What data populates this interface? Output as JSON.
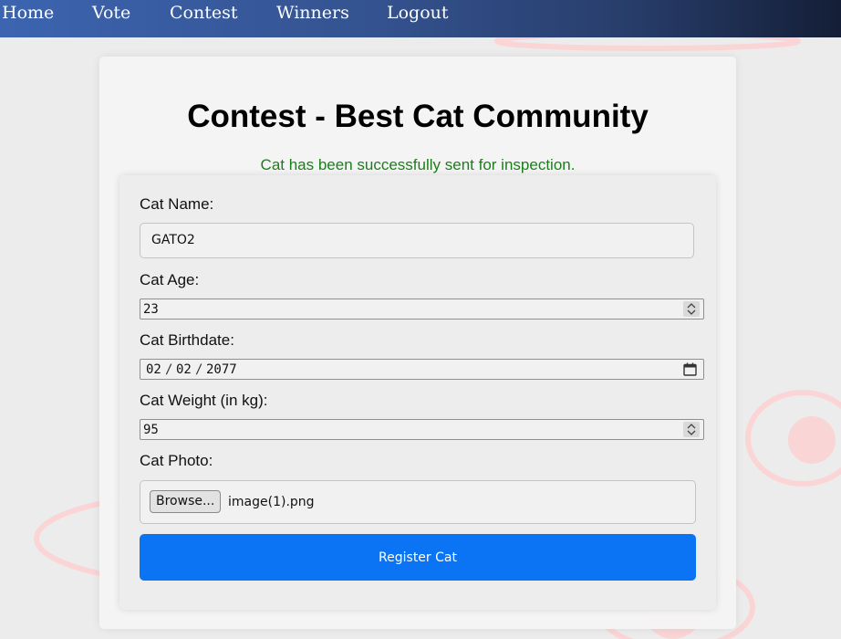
{
  "nav": {
    "items": [
      {
        "label": "Home"
      },
      {
        "label": "Vote"
      },
      {
        "label": "Contest"
      },
      {
        "label": "Winners"
      },
      {
        "label": "Logout"
      }
    ]
  },
  "page": {
    "title": "Contest - Best Cat Community",
    "success_message": "Cat has been successfully sent for inspection.",
    "success_color": "#1a7f1a"
  },
  "form": {
    "cat_name": {
      "label": "Cat Name:",
      "value": "GATO2"
    },
    "cat_age": {
      "label": "Cat Age:",
      "value": "23"
    },
    "cat_birthdate": {
      "label": "Cat Birthdate:",
      "month": "02",
      "day": "02",
      "year": "2077",
      "separator": "/"
    },
    "cat_weight": {
      "label": "Cat Weight (in kg):",
      "value": "95"
    },
    "cat_photo": {
      "label": "Cat Photo:",
      "browse_label": "Browse...",
      "file_name": "image(1).png"
    },
    "submit_label": "Register Cat",
    "submit_color": "#0a74f5"
  }
}
